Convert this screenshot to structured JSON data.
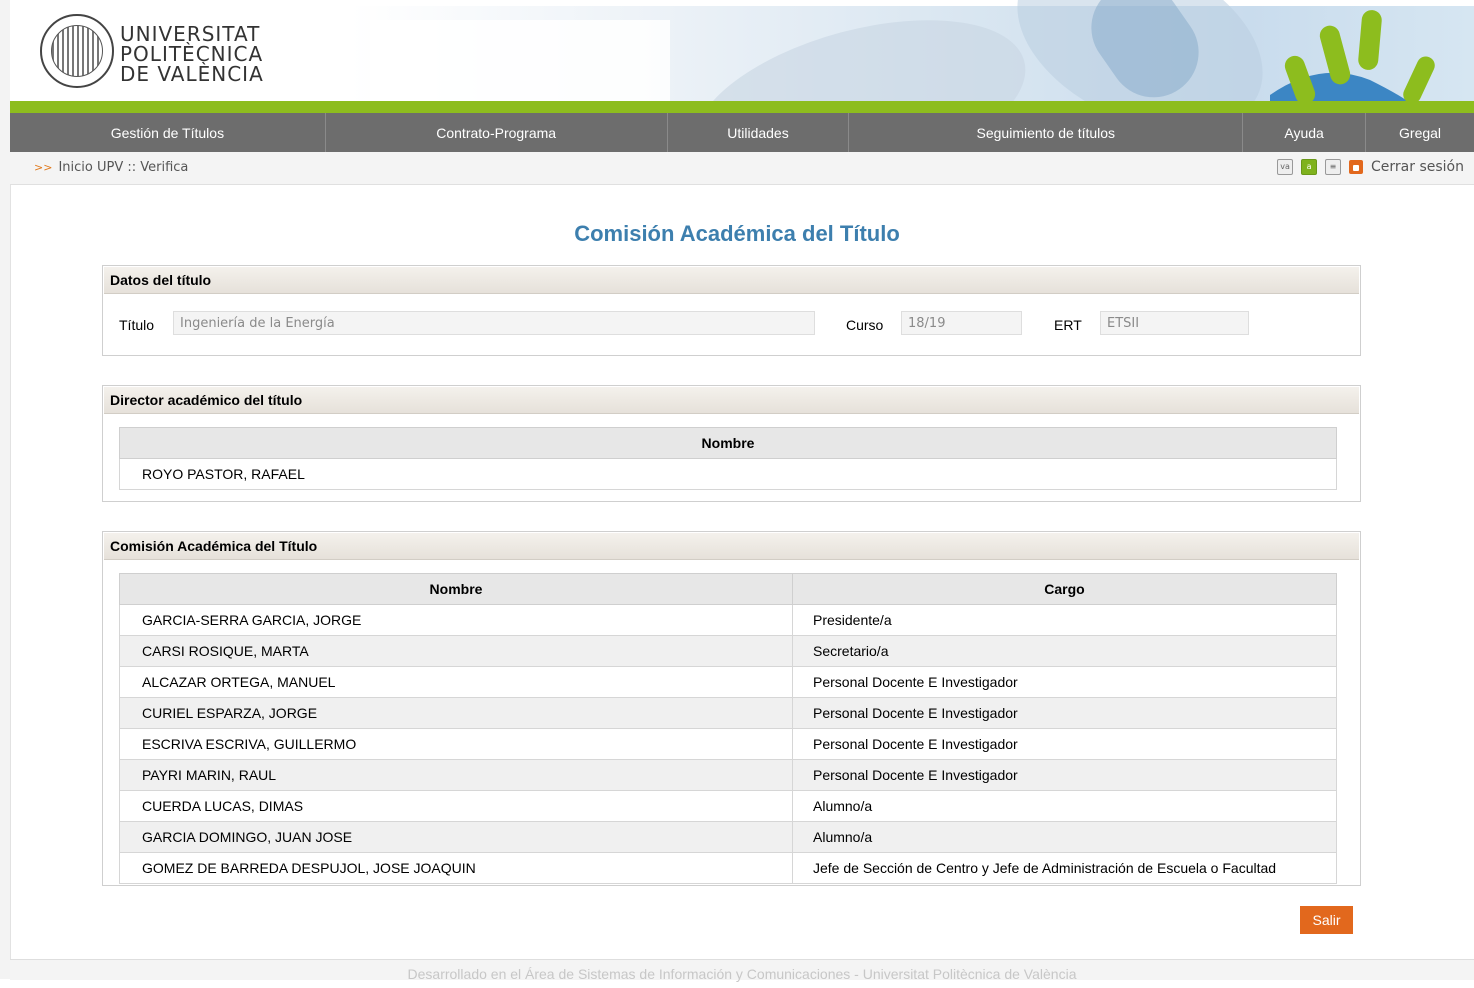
{
  "header": {
    "university_lines": [
      "UNIVERSITAT",
      "POLITÈCNICA",
      "DE VALÈNCIA"
    ]
  },
  "nav": {
    "items": [
      {
        "label": "Gestión de Títulos"
      },
      {
        "label": "Contrato-Programa"
      },
      {
        "label": "Utilidades"
      },
      {
        "label": "Seguimiento de títulos"
      },
      {
        "label": "Ayuda"
      },
      {
        "label": "Gregal"
      }
    ]
  },
  "breadcrumb": {
    "arrows": ">>",
    "text": "Inicio UPV :: Verifica"
  },
  "tools": {
    "icon_va": "va",
    "icon_a": "a",
    "logout": "Cerrar sesión"
  },
  "page_title": "Comisión Académica del Título",
  "datos": {
    "heading": "Datos del título",
    "titulo_label": "Título",
    "titulo_value": "Ingeniería de la Energía",
    "curso_label": "Curso",
    "curso_value": "18/19",
    "ert_label": "ERT",
    "ert_value": "ETSII"
  },
  "director": {
    "heading": "Director académico del título",
    "column": "Nombre",
    "name": "ROYO PASTOR, RAFAEL"
  },
  "comision": {
    "heading": "Comisión Académica del Título",
    "columns": [
      "Nombre",
      "Cargo"
    ],
    "rows": [
      {
        "nombre": "GARCIA-SERRA GARCIA, JORGE",
        "cargo": "Presidente/a"
      },
      {
        "nombre": "CARSI ROSIQUE, MARTA",
        "cargo": "Secretario/a"
      },
      {
        "nombre": "ALCAZAR ORTEGA, MANUEL",
        "cargo": "Personal Docente E Investigador"
      },
      {
        "nombre": "CURIEL ESPARZA, JORGE",
        "cargo": "Personal Docente E Investigador"
      },
      {
        "nombre": "ESCRIVA ESCRIVA, GUILLERMO",
        "cargo": "Personal Docente E Investigador"
      },
      {
        "nombre": "PAYRI MARIN, RAUL",
        "cargo": "Personal Docente E Investigador"
      },
      {
        "nombre": "CUERDA LUCAS, DIMAS",
        "cargo": "Alumno/a"
      },
      {
        "nombre": "GARCIA DOMINGO, JUAN JOSE",
        "cargo": "Alumno/a"
      },
      {
        "nombre": "GOMEZ DE BARREDA DESPUJOL, JOSE JOAQUIN",
        "cargo": "Jefe de Sección de Centro y Jefe de Administración de Escuela o Facultad"
      }
    ]
  },
  "salir_label": "Salir",
  "footer": "Desarrollado en el Área de Sistemas de Información y Comunicaciones - Universitat Politècnica de València",
  "colors": {
    "accent_green": "#8dbd1e",
    "nav_gray": "#6d6d6d",
    "title_blue": "#3d7fae",
    "button_orange": "#e2681d"
  }
}
